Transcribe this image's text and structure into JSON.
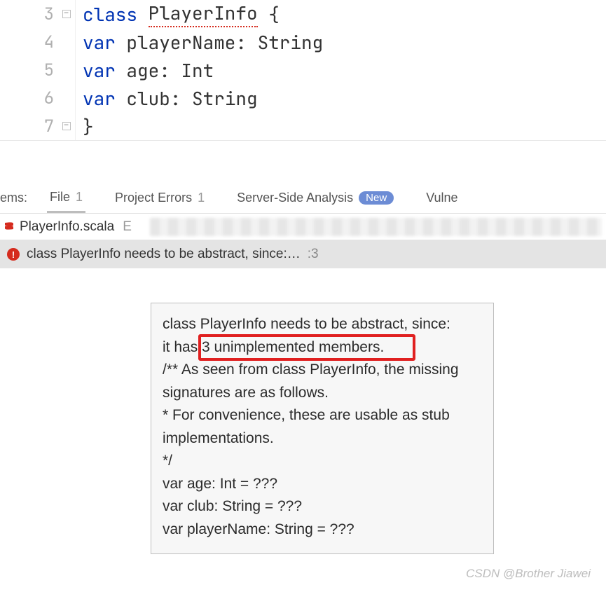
{
  "editor": {
    "lines": [
      {
        "num": "3",
        "indent": "",
        "tokens": [
          [
            "kw",
            "class "
          ],
          [
            "cls_err",
            "PlayerInfo"
          ],
          [
            "plain",
            " {"
          ]
        ],
        "fold": true
      },
      {
        "num": "4",
        "indent": "  ",
        "tokens": [
          [
            "kw",
            "var "
          ],
          [
            "plain",
            "playerName: "
          ],
          [
            "type",
            "String"
          ]
        ]
      },
      {
        "num": "5",
        "indent": "  ",
        "tokens": [
          [
            "kw",
            "var "
          ],
          [
            "plain",
            "age: "
          ],
          [
            "type",
            "Int"
          ]
        ]
      },
      {
        "num": "6",
        "indent": "  ",
        "tokens": [
          [
            "kw",
            "var "
          ],
          [
            "plain",
            "club: "
          ],
          [
            "type",
            "String"
          ]
        ]
      },
      {
        "num": "7",
        "indent": "",
        "tokens": [
          [
            "plain",
            "}"
          ]
        ],
        "fold": true
      }
    ]
  },
  "tabs": {
    "prefix": "ems:",
    "items": [
      {
        "label": "File",
        "count": "1",
        "active": true
      },
      {
        "label": "Project Errors",
        "count": "1"
      },
      {
        "label": "Server-Side Analysis",
        "badge": "New"
      },
      {
        "label": "Vulne"
      }
    ]
  },
  "filebar": {
    "filename": "PlayerInfo.scala",
    "trail": "E"
  },
  "error_row": {
    "message": "class PlayerInfo needs to be abstract, since:…",
    "line_ref": ":3"
  },
  "tooltip": {
    "lines": [
      "class PlayerInfo needs to be abstract, since:",
      "it has 3 unimplemented members.",
      "/** As seen from class PlayerInfo, the missing signatures are as follows.",
      "* For convenience, these are usable as stub implementations.",
      "*/",
      "var age: Int = ???",
      "var club: String = ???",
      "var playerName: String = ???"
    ],
    "highlight_text": "3 unimplemented members"
  },
  "watermark": "CSDN @Brother Jiawei"
}
